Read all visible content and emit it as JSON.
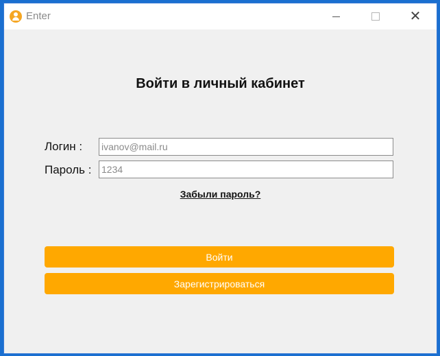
{
  "window": {
    "title": "Enter"
  },
  "main": {
    "heading": "Войти в личный кабинет",
    "login_label": "Логин :",
    "login_placeholder": "ivanov@mail.ru",
    "password_label": "Пароль :",
    "password_placeholder": "1234",
    "forgot_link": "Забыли пароль?",
    "login_button": "Войти",
    "register_button": "Зарегистрироваться"
  },
  "icons": {
    "app": "user-icon",
    "minimize": "minimize-icon",
    "maximize": "maximize-icon",
    "close": "close-icon"
  },
  "colors": {
    "accent": "#ffa800",
    "background": "#f0f0f0",
    "titlebar": "#ffffff"
  }
}
